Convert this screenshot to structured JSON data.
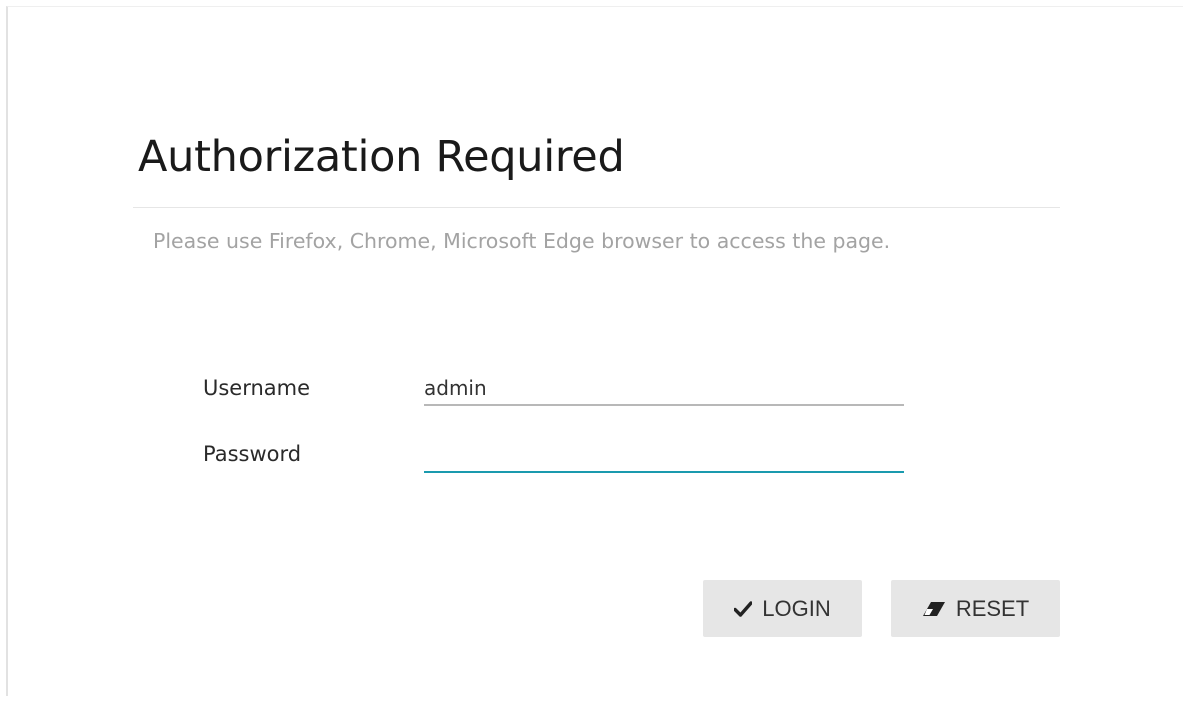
{
  "title": "Authorization Required",
  "notice": "Please use Firefox, Chrome, Microsoft Edge browser to access the page.",
  "form": {
    "username_label": "Username",
    "username_value": "admin",
    "password_label": "Password",
    "password_value": ""
  },
  "buttons": {
    "login_label": "LOGIN",
    "login_icon": "check-icon",
    "reset_label": "RESET",
    "reset_icon": "eraser-icon"
  },
  "colors": {
    "focus_underline": "#1a9aae",
    "button_bg": "#e6e6e6",
    "notice_text": "#a3a3a3"
  }
}
